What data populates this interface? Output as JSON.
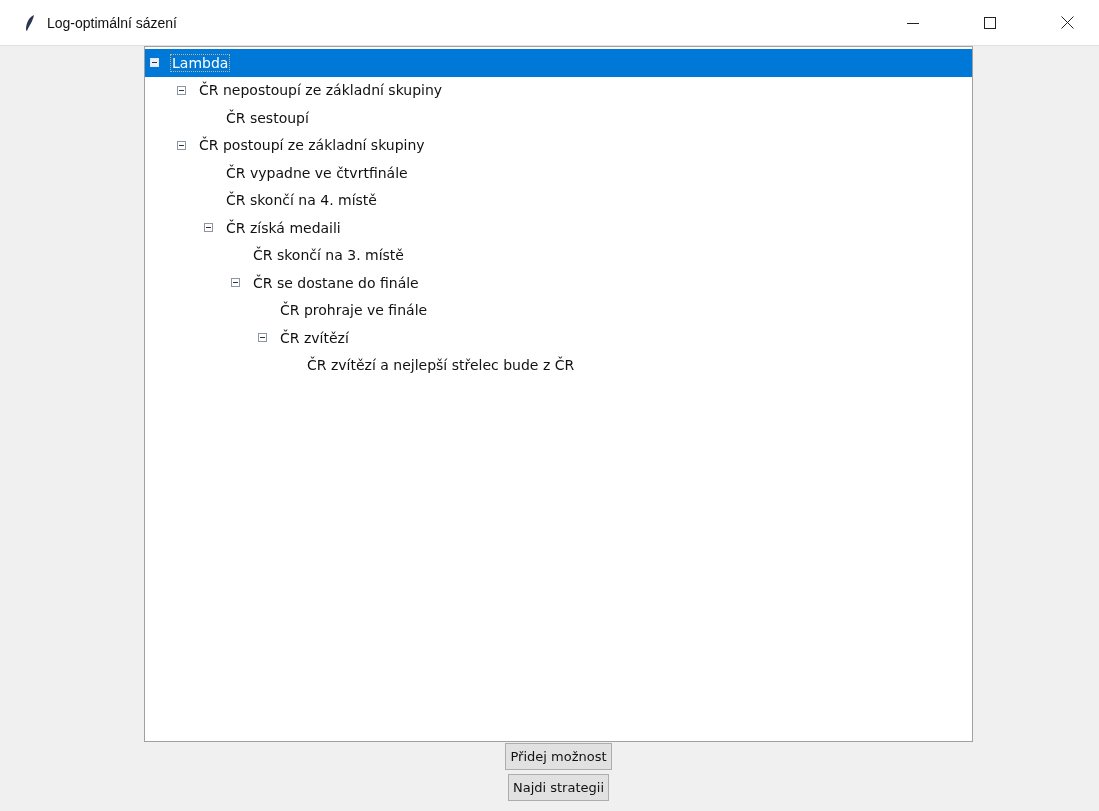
{
  "window": {
    "title": "Log-optimální sázení"
  },
  "tree": {
    "items": [
      {
        "label": "Lambda",
        "selected": true,
        "expanded": true,
        "children": [
          {
            "label": "ČR nepostoupí ze základní skupiny",
            "selected": false,
            "expanded": true,
            "children": [
              {
                "label": "ČR sestoupí",
                "selected": false
              }
            ]
          },
          {
            "label": "ČR postoupí ze základní skupiny",
            "selected": false,
            "expanded": true,
            "children": [
              {
                "label": "ČR vypadne ve čtvrtfinále",
                "selected": false
              },
              {
                "label": "ČR skončí na 4. místě",
                "selected": false
              },
              {
                "label": "ČR získá medaili",
                "selected": false,
                "expanded": true,
                "children": [
                  {
                    "label": "ČR skončí na 3. místě",
                    "selected": false
                  },
                  {
                    "label": "ČR se dostane do finále",
                    "selected": false,
                    "expanded": true,
                    "children": [
                      {
                        "label": "ČR prohraje ve finále",
                        "selected": false
                      },
                      {
                        "label": "ČR zvítězí",
                        "selected": false,
                        "expanded": true,
                        "children": [
                          {
                            "label": "ČR zvítězí a nejlepší střelec bude z ČR",
                            "selected": false
                          }
                        ]
                      }
                    ]
                  }
                ]
              }
            ]
          }
        ]
      }
    ]
  },
  "buttons": [
    "Přidej možnost",
    "Najdi strategii"
  ]
}
